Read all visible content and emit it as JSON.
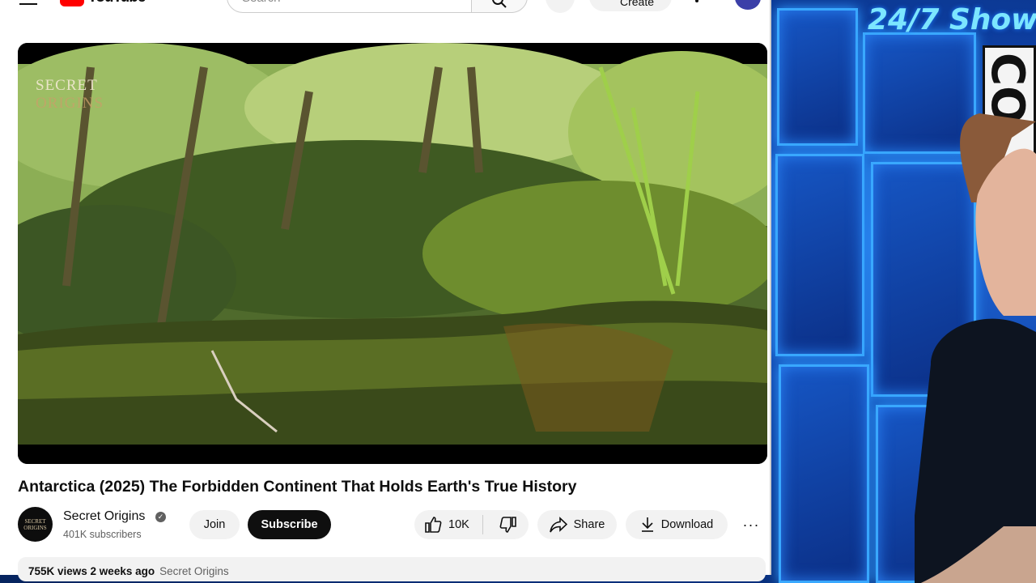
{
  "stream": {
    "show_title": "24/7 Show",
    "sign_text": "CO"
  },
  "youtube": {
    "logo_text": "YouTube",
    "search_placeholder": "Search",
    "create_label": "Create",
    "video": {
      "watermark_line1": "SECRET",
      "watermark_line2": "ORIGINS",
      "title": "Antarctica (2025) The Forbidden Continent That Holds Earth's True History"
    },
    "channel": {
      "avatar_text": "SECRET ORIGINS",
      "name": "Secret Origins",
      "verified_mark": "✓",
      "subscribers": "401K subscribers"
    },
    "actions": {
      "join": "Join",
      "subscribe": "Subscribe",
      "likes": "10K",
      "share": "Share",
      "download": "Download",
      "more": "···"
    },
    "description": {
      "stats": "755K views  2 weeks ago",
      "source": "Secret Origins"
    }
  },
  "colors": {
    "youtube_red": "#ff0000",
    "backdrop_blue": "#0d3c9c",
    "neon_cyan": "#7ce6ff"
  }
}
